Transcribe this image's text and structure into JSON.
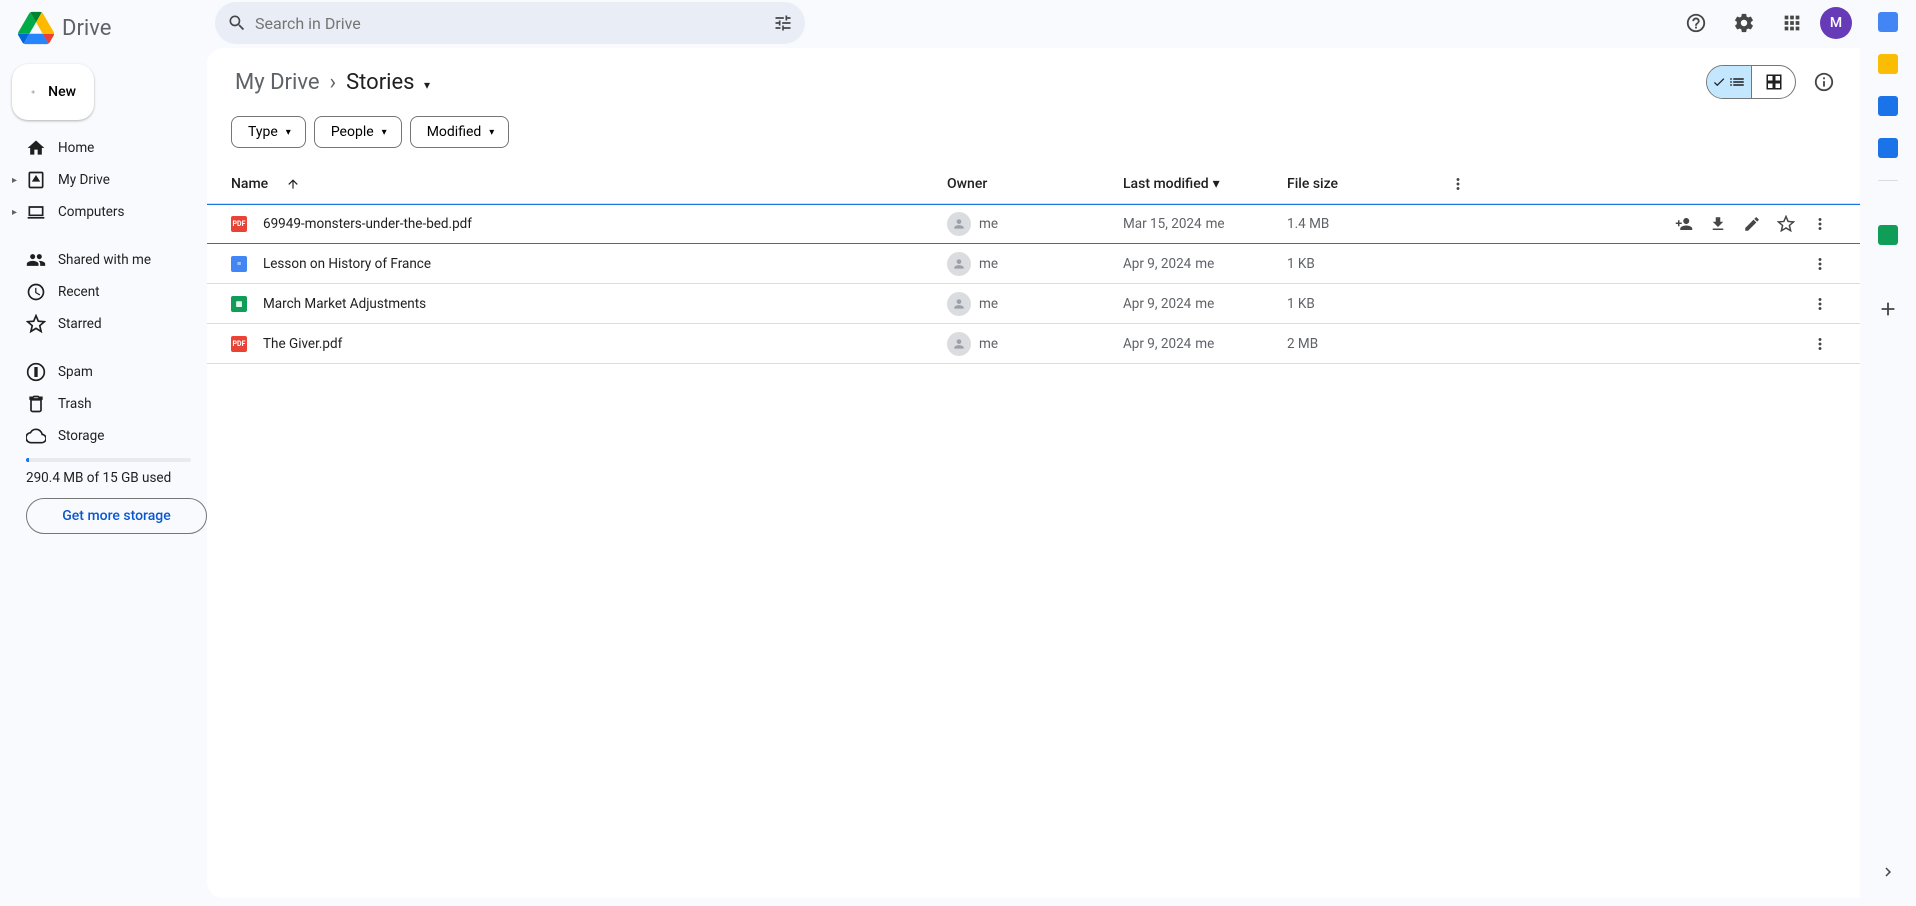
{
  "app": {
    "name": "Drive",
    "avatar_letter": "M"
  },
  "search": {
    "placeholder": "Search in Drive"
  },
  "sidebar": {
    "new_label": "New",
    "items": [
      {
        "label": "Home",
        "icon": "home"
      },
      {
        "label": "My Drive",
        "icon": "drive",
        "expandable": true
      },
      {
        "label": "Computers",
        "icon": "computers",
        "expandable": true
      },
      {
        "label": "Shared with me",
        "icon": "people"
      },
      {
        "label": "Recent",
        "icon": "clock"
      },
      {
        "label": "Starred",
        "icon": "star"
      },
      {
        "label": "Spam",
        "icon": "spam"
      },
      {
        "label": "Trash",
        "icon": "trash"
      },
      {
        "label": "Storage",
        "icon": "cloud"
      }
    ],
    "storage_text": "290.4 MB of 15 GB used",
    "storage_btn": "Get more storage"
  },
  "breadcrumbs": {
    "parent": "My Drive",
    "current": "Stories"
  },
  "filters": {
    "type": "Type",
    "people": "People",
    "modified": "Modified"
  },
  "columns": {
    "name": "Name",
    "owner": "Owner",
    "modified": "Last modified",
    "size": "File size"
  },
  "files": [
    {
      "name": "69949-monsters-under-the-bed.pdf",
      "type": "pdf",
      "owner": "me",
      "modified": "Mar 15, 2024",
      "modified_by": "me",
      "size": "1.4 MB",
      "selected": true
    },
    {
      "name": "Lesson on History of France",
      "type": "doc",
      "owner": "me",
      "modified": "Apr 9, 2024",
      "modified_by": "me",
      "size": "1 KB",
      "selected": false
    },
    {
      "name": "March Market Adjustments",
      "type": "sheet",
      "owner": "me",
      "modified": "Apr 9, 2024",
      "modified_by": "me",
      "size": "1 KB",
      "selected": false
    },
    {
      "name": "The Giver.pdf",
      "type": "pdf",
      "owner": "me",
      "modified": "Apr 9, 2024",
      "modified_by": "me",
      "size": "2 MB",
      "selected": false
    }
  ],
  "sidepanel_apps": [
    {
      "name": "calendar",
      "color": "#4285f4"
    },
    {
      "name": "keep",
      "color": "#fbbc04"
    },
    {
      "name": "tasks",
      "color": "#1a73e8"
    },
    {
      "name": "contacts",
      "color": "#1a73e8"
    }
  ]
}
